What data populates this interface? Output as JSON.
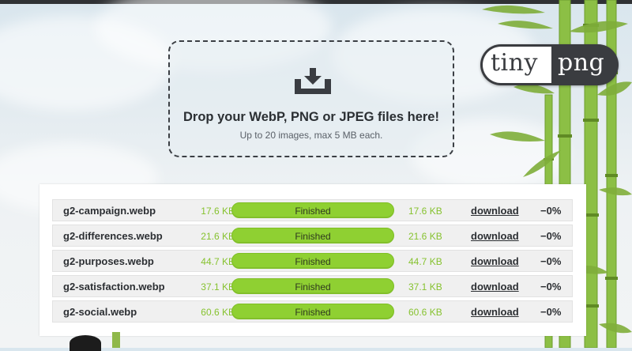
{
  "dropzone": {
    "title": "Drop your WebP, PNG or JPEG files here!",
    "subtitle": "Up to 20 images, max 5 MB each.",
    "icon": "download-tray-icon"
  },
  "logo": {
    "left": "tiny",
    "right": "png"
  },
  "results": [
    {
      "name": "g2-campaign.webp",
      "before": "17.6 KB",
      "status": "Finished",
      "progress": 100,
      "after": "17.6 KB",
      "download": "download",
      "saving": "−0%"
    },
    {
      "name": "g2-differences.webp",
      "before": "21.6 KB",
      "status": "Finished",
      "progress": 100,
      "after": "21.6 KB",
      "download": "download",
      "saving": "−0%"
    },
    {
      "name": "g2-purposes.webp",
      "before": "44.7 KB",
      "status": "Finished",
      "progress": 100,
      "after": "44.7 KB",
      "download": "download",
      "saving": "−0%"
    },
    {
      "name": "g2-satisfaction.webp",
      "before": "37.1 KB",
      "status": "Finished",
      "progress": 100,
      "after": "37.1 KB",
      "download": "download",
      "saving": "−0%"
    },
    {
      "name": "g2-social.webp",
      "before": "60.6 KB",
      "status": "Finished",
      "progress": 100,
      "after": "60.6 KB",
      "download": "download",
      "saving": "−0%"
    }
  ],
  "colors": {
    "accent_green": "#8fd032",
    "size_green": "#86c22f",
    "logo_dark": "#3a3c40"
  }
}
